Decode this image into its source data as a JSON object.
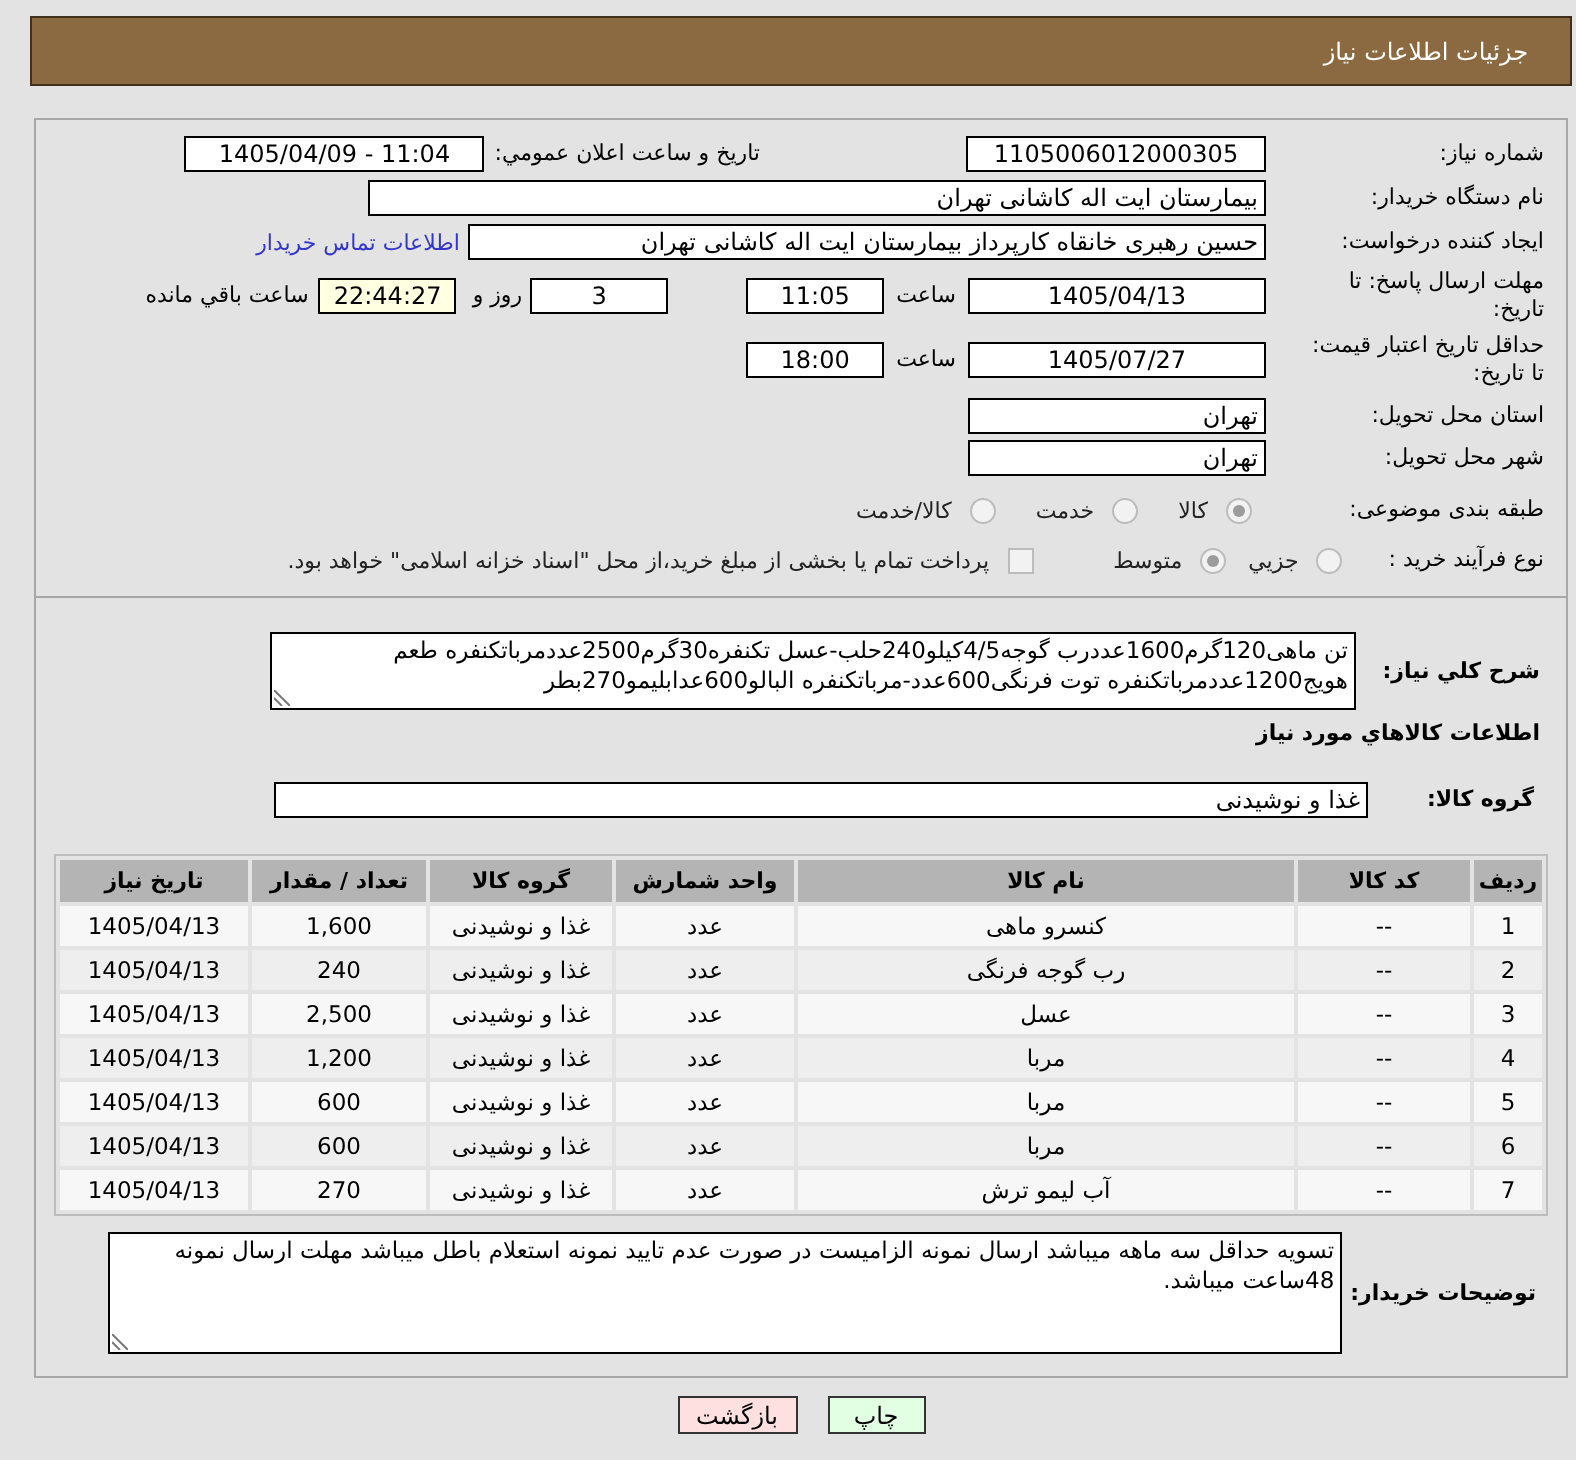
{
  "header": {
    "title": "جزئیات اطلاعات نیاز"
  },
  "details": {
    "need_number": {
      "label": "شماره نیاز:",
      "value": "1105006012000305"
    },
    "announcement": {
      "label": "تاریخ و ساعت اعلان عمومي:",
      "value": "1405/04/09 - 11:04"
    },
    "buyer_org": {
      "label": "نام دستگاه خریدار:",
      "value": "بیمارستان ایت اله کاشانی تهران"
    },
    "requester": {
      "label": "ایجاد کننده درخواست:",
      "value": "حسین رهبری خانقاه کارپرداز بیمارستان ایت اله کاشانی تهران",
      "contact_link": "اطلاعات تماس خریدار"
    },
    "response_deadline": {
      "label": "مهلت ارسال پاسخ: تا تاریخ:",
      "date": "1405/04/13",
      "time_label": "ساعت",
      "time": "11:05",
      "days": "3",
      "days_label": "روز و",
      "remaining": "22:44:27",
      "remaining_label": "ساعت باقي مانده"
    },
    "price_validity": {
      "label": "حداقل تاریخ اعتبار قیمت: تا تاریخ:",
      "date": "1405/07/27",
      "time_label": "ساعت",
      "time": "18:00"
    },
    "delivery_province": {
      "label": "استان محل تحویل:",
      "value": "تهران"
    },
    "delivery_city": {
      "label": "شهر محل تحویل:",
      "value": "تهران"
    },
    "subject_category": {
      "label": "طبقه بندی موضوعی:",
      "options": [
        {
          "label": "کالا",
          "selected": true,
          "disabled": true
        },
        {
          "label": "خدمت",
          "selected": false,
          "disabled": true
        },
        {
          "label": "کالا/خدمت",
          "selected": false,
          "disabled": true
        }
      ]
    },
    "purchase_process": {
      "label": "نوع فرآیند خرید :",
      "options": [
        {
          "label": "جزيي",
          "selected": false,
          "disabled": true
        },
        {
          "label": "متوسط",
          "selected": true,
          "disabled": true
        }
      ],
      "treasury_payment": {
        "label": "پرداخت تمام یا بخشی از مبلغ خرید،از محل \"اسناد خزانه اسلامی\" خواهد بود.",
        "checked": false,
        "disabled": true
      }
    }
  },
  "description": {
    "label": "شرح کلي نیاز:",
    "text": "تن ماهی120گرم1600عددرب گوجه4/5کیلو240حلب-عسل تکنفره30گرم2500عددمرباتکنفره طعم هویج1200عددمرباتکنفره توت فرنگی600عدد-مرباتکنفره البالو600عدابلیمو270بطر"
  },
  "goods": {
    "title": "اطلاعات کالاهاي مورد نیاز",
    "group": {
      "label": "گروه کالا:",
      "value": "غذا و نوشیدنی"
    },
    "table": {
      "columns": [
        "ردیف",
        "کد کالا",
        "نام کالا",
        "واحد شمارش",
        "گروه کالا",
        "تعداد / مقدار",
        "تاریخ نیاز"
      ],
      "rows": [
        [
          "1",
          "--",
          "کنسرو ماهی",
          "عدد",
          "غذا و نوشیدنی",
          "1,600",
          "1405/04/13"
        ],
        [
          "2",
          "--",
          "رب گوجه فرنگی",
          "عدد",
          "غذا و نوشیدنی",
          "240",
          "1405/04/13"
        ],
        [
          "3",
          "--",
          "عسل",
          "عدد",
          "غذا و نوشیدنی",
          "2,500",
          "1405/04/13"
        ],
        [
          "4",
          "--",
          "مربا",
          "عدد",
          "غذا و نوشیدنی",
          "1,200",
          "1405/04/13"
        ],
        [
          "5",
          "--",
          "مربا",
          "عدد",
          "غذا و نوشیدنی",
          "600",
          "1405/04/13"
        ],
        [
          "6",
          "--",
          "مربا",
          "عدد",
          "غذا و نوشیدنی",
          "600",
          "1405/04/13"
        ],
        [
          "7",
          "--",
          "آب لیمو ترش",
          "عدد",
          "غذا و نوشیدنی",
          "270",
          "1405/04/13"
        ]
      ]
    }
  },
  "buyer_notes": {
    "label": "توضیحات خریدار:",
    "text": "تسویه حداقل سه ماهه میباشد ارسال نمونه الزامیست در صورت عدم تایید نمونه استعلام باطل میباشد مهلت ارسال نمونه 48ساعت میباشد."
  },
  "buttons": [
    {
      "label": "چاپ",
      "kind": "print"
    },
    {
      "label": "بازگشت",
      "kind": "back"
    }
  ]
}
